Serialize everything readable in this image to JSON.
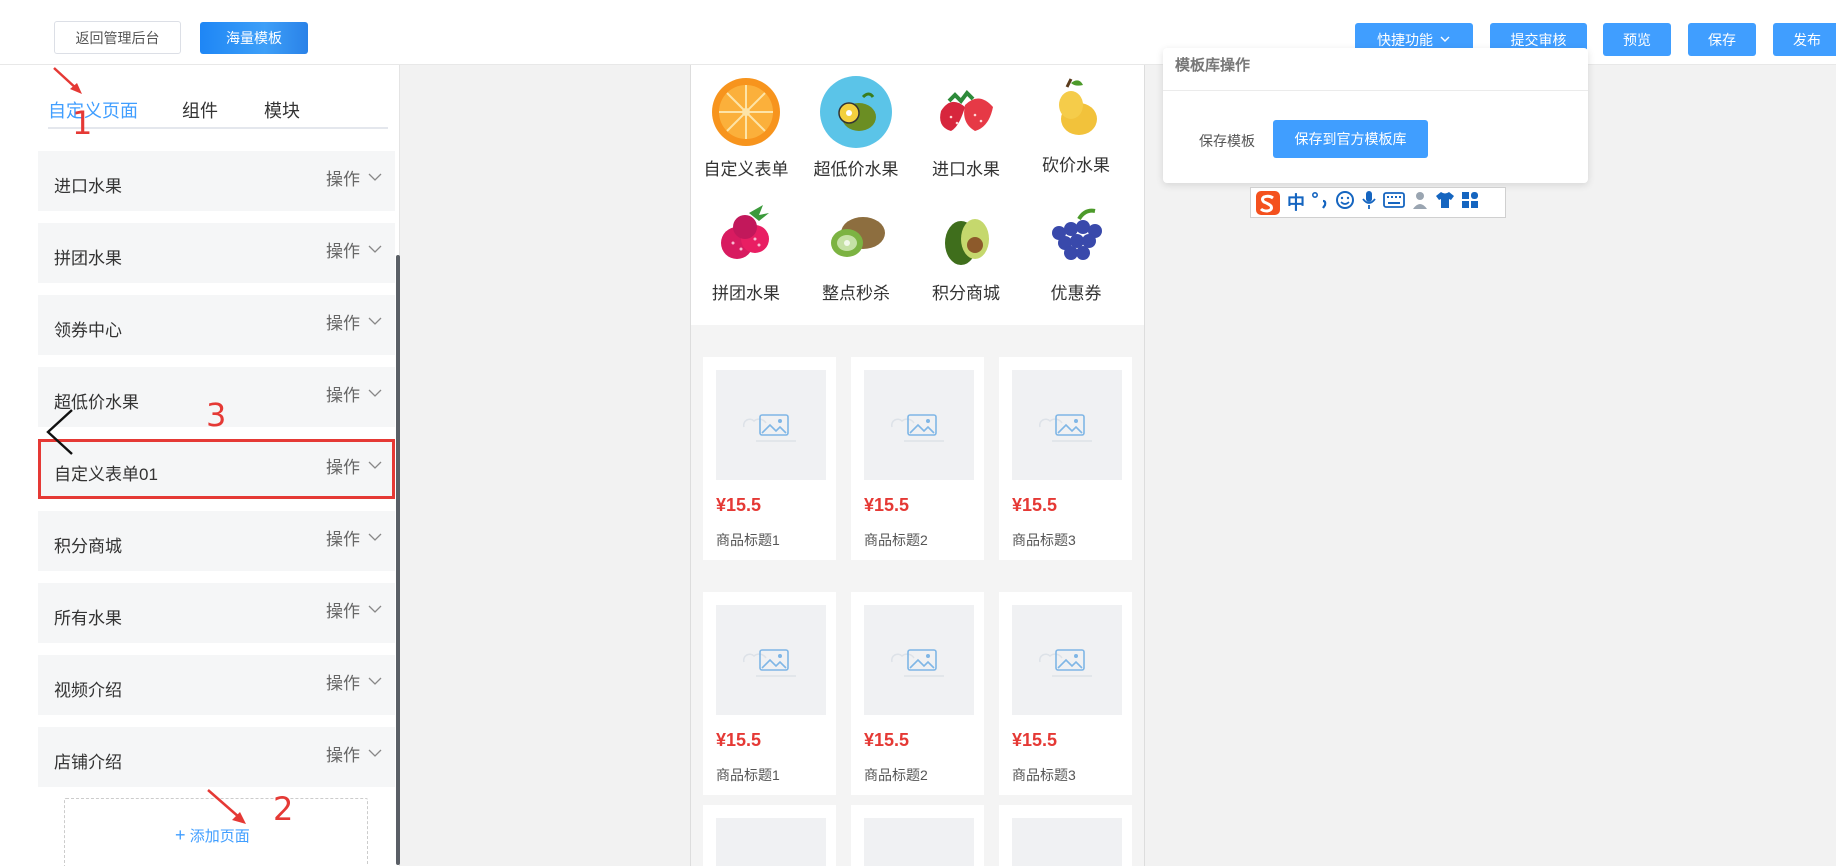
{
  "header": {
    "back_label": "返回管理后台",
    "massive_label": "海量模板",
    "quick_label": "快捷功能",
    "submit_label": "提交审核",
    "preview_label": "预览",
    "save_label": "保存",
    "publish_label": "发布"
  },
  "left": {
    "tabs": [
      "自定义页面",
      "组件",
      "模块"
    ],
    "pages": [
      {
        "label": "进口水果",
        "op": "操作"
      },
      {
        "label": "拼团水果",
        "op": "操作"
      },
      {
        "label": "领券中心",
        "op": "操作"
      },
      {
        "label": "超低价水果",
        "op": "操作"
      },
      {
        "label": "自定义表单01",
        "op": "操作"
      },
      {
        "label": "积分商城",
        "op": "操作"
      },
      {
        "label": "所有水果",
        "op": "操作"
      },
      {
        "label": "视频介绍",
        "op": "操作"
      },
      {
        "label": "店铺介绍",
        "op": "操作"
      }
    ],
    "add_label": "添加页面"
  },
  "annotations": [
    "1",
    "2",
    "3"
  ],
  "preview": {
    "nav": [
      {
        "label": "自定义表单",
        "icon": "orange-icon"
      },
      {
        "label": "超低价水果",
        "icon": "kiwi-icon"
      },
      {
        "label": "进口水果",
        "icon": "strawberry-icon"
      },
      {
        "label": "砍价水果",
        "icon": "pear-icon"
      },
      {
        "label": "拼团水果",
        "icon": "raspberry-icon"
      },
      {
        "label": "整点秒杀",
        "icon": "kiwi-half-icon"
      },
      {
        "label": "积分商城",
        "icon": "avocado-icon"
      },
      {
        "label": "优惠券",
        "icon": "grape-icon"
      }
    ],
    "goods": [
      {
        "price": "¥15.5",
        "title": "商品标题1"
      },
      {
        "price": "¥15.5",
        "title": "商品标题2"
      },
      {
        "price": "¥15.5",
        "title": "商品标题3"
      },
      {
        "price": "¥15.5",
        "title": "商品标题1"
      },
      {
        "price": "¥15.5",
        "title": "商品标题2"
      },
      {
        "price": "¥15.5",
        "title": "商品标题3"
      }
    ]
  },
  "template_panel": {
    "header": "模板库操作",
    "save_template_label": "保存模板",
    "save_official_label": "保存到官方模板库"
  },
  "ime": {
    "glyph_zh": "中"
  },
  "colors": {
    "primary": "#409eff",
    "annotation": "#e53935",
    "price": "#e53935"
  }
}
